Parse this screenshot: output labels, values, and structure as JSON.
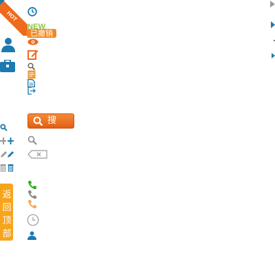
{
  "hot_badge": {
    "text": "HOT"
  },
  "new_badge": {
    "text": "NEW"
  },
  "revoked_badge": {
    "text": "已撤销"
  },
  "search_button": {
    "label": "搜 索"
  },
  "back_to_top": {
    "chars": [
      "返",
      "回",
      "顶",
      "部"
    ]
  },
  "colors": {
    "blue": "#1c7ab0",
    "orange": "#ee6a1d",
    "green_new": "#8cc63f",
    "back_top": "#f7a41d",
    "grey": "#8a8a8a",
    "phone_green": "#31b21d",
    "phone_orange": "#f2ac5e"
  },
  "icons": [
    "clock-icon",
    "eye-icon",
    "edit-icon",
    "magnifier-small-icon",
    "notes-icon",
    "document-icon",
    "export-icon",
    "user-icon",
    "toolbox-icon",
    "search-small-icon",
    "add-icon",
    "pencil-icon",
    "trash-icon",
    "search-grey-icon",
    "delete-key-icon",
    "phone-green-icon",
    "phone-grey-icon",
    "phone-orange-icon",
    "history-icon",
    "person-icon"
  ]
}
